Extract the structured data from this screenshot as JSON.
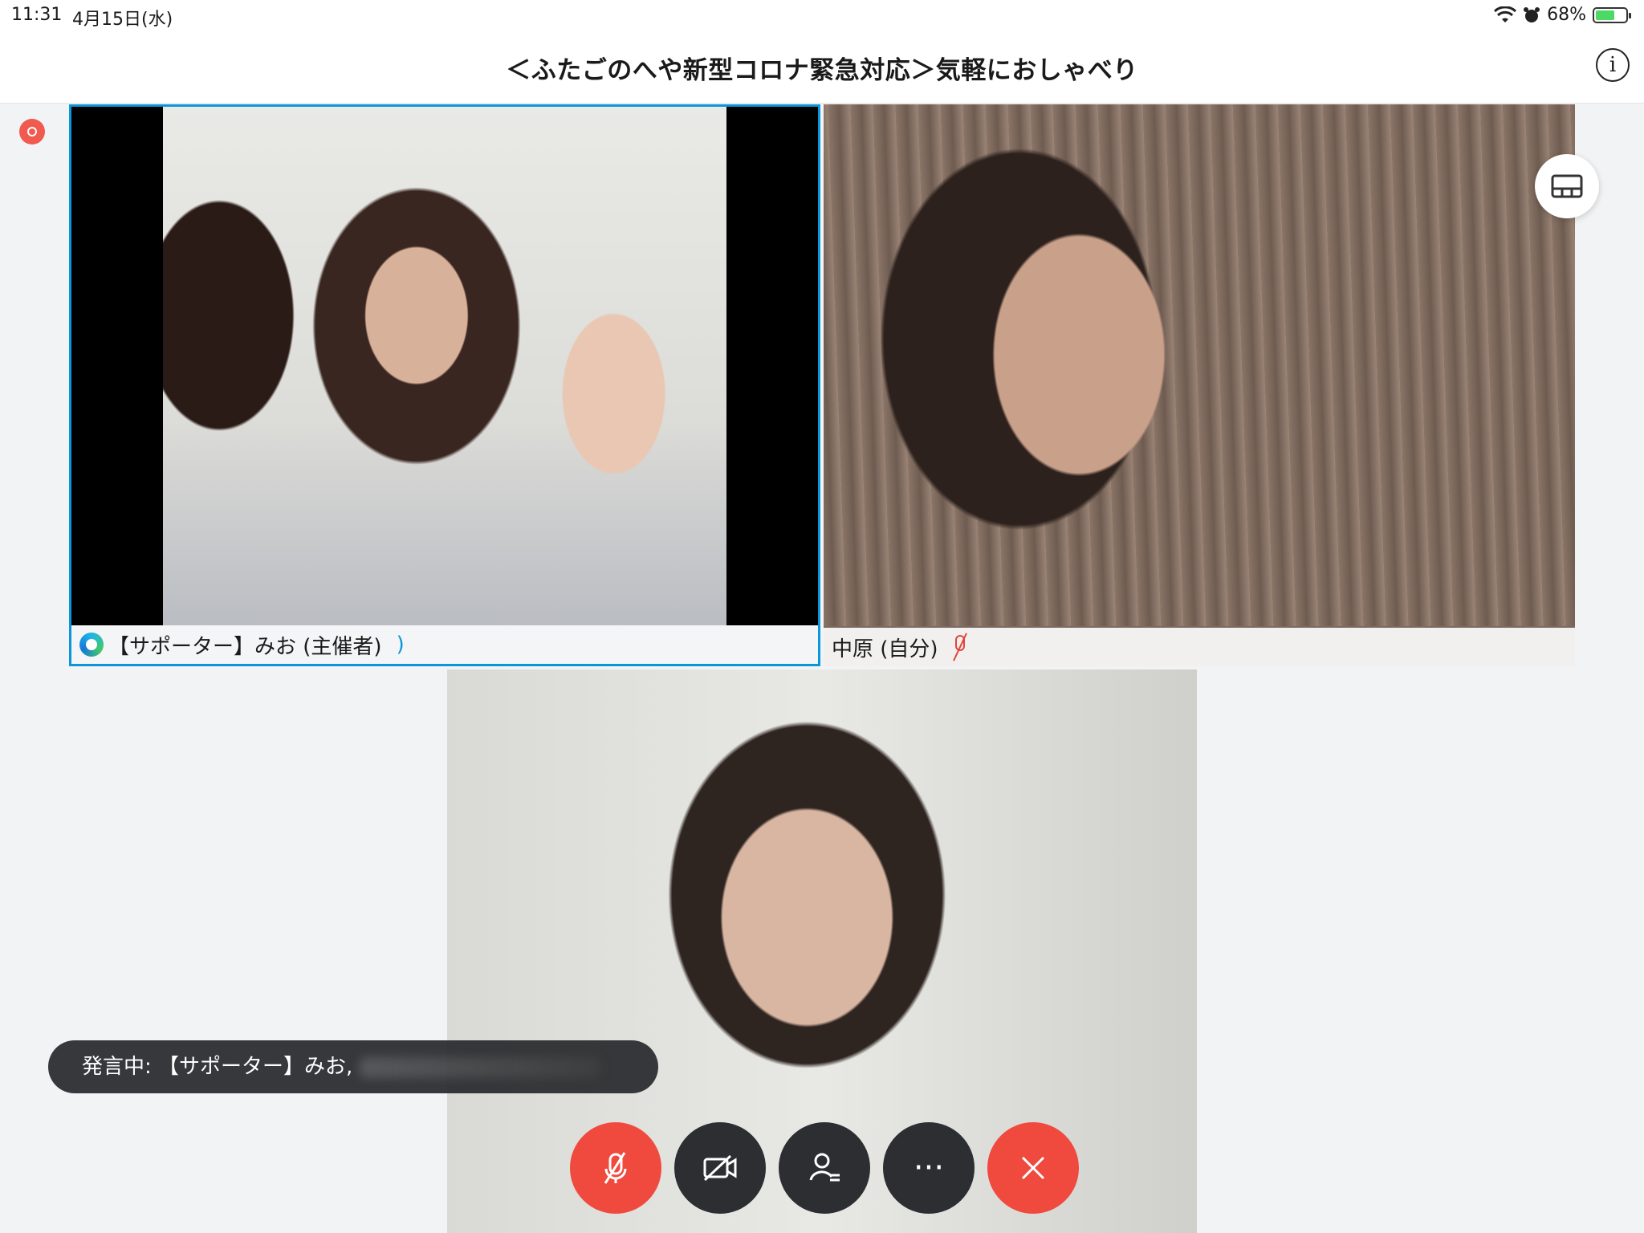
{
  "status_bar": {
    "time": "11:31",
    "date": "4月15日(水)",
    "battery_percent": "68%",
    "battery_level": 0.68
  },
  "meeting": {
    "title": "＜ふたごのへや新型コロナ緊急対応＞気軽におしゃべり"
  },
  "participants": [
    {
      "name": "【サポーター】みお (主催者)",
      "speaking": true,
      "host": true
    },
    {
      "name": "中原 (自分)",
      "muted": true
    },
    {
      "name": "",
      "muted": false
    }
  ],
  "speaker_banner": {
    "text": "発言中: 【サポーター】みお,"
  },
  "controls": {
    "mute_icon": "mic-muted-icon",
    "video_icon": "video-off-icon",
    "participants_icon": "participants-icon",
    "more_label": "···",
    "leave_icon": "close-icon"
  },
  "colors": {
    "accent": "#0a96d9",
    "end_call": "#f0493e",
    "control_dark": "#2c2e31",
    "record": "#f05a4f"
  }
}
